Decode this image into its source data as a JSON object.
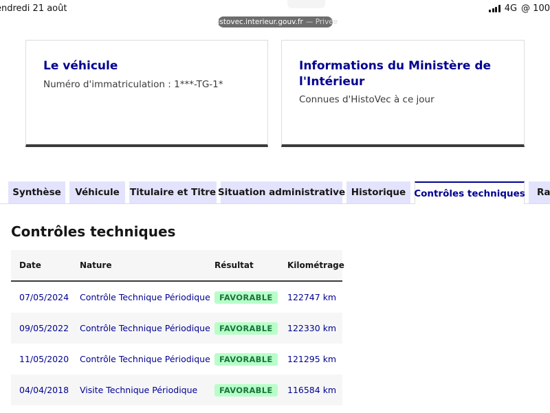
{
  "status_bar": {
    "date": "endredi 21 août",
    "network": "4G",
    "extra": "@ 100"
  },
  "browser": {
    "url": "histovec.interieur.gouv.fr",
    "mode": "— Privée"
  },
  "cards": [
    {
      "title": "Le véhicule",
      "desc": "Numéro d'immatriculation : 1***-TG-1*"
    },
    {
      "title": "Informations du Ministère de l'Intérieur",
      "desc": "Connues d'HistoVec à ce jour"
    }
  ],
  "tabs": [
    {
      "label": "Synthèse"
    },
    {
      "label": "Véhicule"
    },
    {
      "label": "Titulaire et Titre"
    },
    {
      "label": "Situation administrative"
    },
    {
      "label": "Historique"
    },
    {
      "label": "Contrôles techniques"
    },
    {
      "label": "Rap"
    }
  ],
  "section_title": "Contrôles techniques",
  "table": {
    "headers": {
      "date": "Date",
      "nature": "Nature",
      "result": "Résultat",
      "km": "Kilométrage"
    },
    "rows": [
      {
        "date": "07/05/2024",
        "nature": "Contrôle Technique Périodique",
        "result": "FAVORABLE",
        "km": "122747 km"
      },
      {
        "date": "09/05/2022",
        "nature": "Contrôle Technique Périodique",
        "result": "FAVORABLE",
        "km": "122330 km"
      },
      {
        "date": "11/05/2020",
        "nature": "Contrôle Technique Périodique",
        "result": "FAVORABLE",
        "km": "121295 km"
      },
      {
        "date": "04/04/2018",
        "nature": "Visite Technique Périodique",
        "result": "FAVORABLE",
        "km": "116584 km"
      }
    ]
  },
  "colors": {
    "accent": "#000091",
    "tab_bg": "#e3e3fd",
    "badge_bg": "#b8fec9",
    "badge_text": "#18753c"
  }
}
